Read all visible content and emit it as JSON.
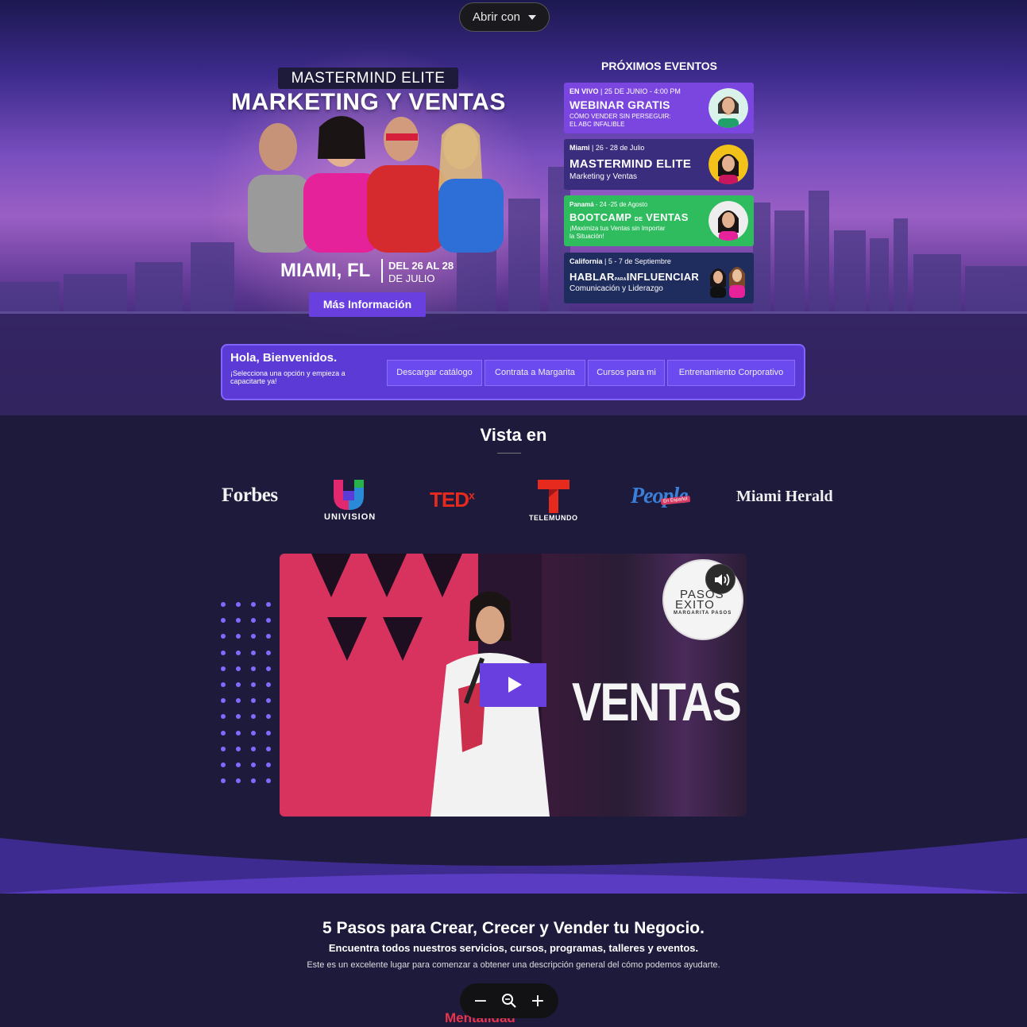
{
  "open_with": {
    "label": "Abrir con"
  },
  "hero": {
    "pill": "MASTERMIND ELITE",
    "title": "MARKETING Y VENTAS",
    "city": "MIAMI, FL",
    "date_line1": "DEL 26 AL 28",
    "date_line2": "DE JULIO",
    "cta": "Más Información"
  },
  "events": {
    "heading": "PRÓXIMOS EVENTOS",
    "items": [
      {
        "meta_strong": "EN VIVO",
        "meta": " | 25 DE JUNIO - 4:00 PM",
        "name": "WEBINAR GRATIS",
        "line1": "CÓMO VENDER SIN PERSEGUIR:",
        "line2": "EL ABC INFALIBLE"
      },
      {
        "meta_strong": "Miami",
        "meta": " | 26 - 28 de Julio",
        "name": "MASTERMIND ELITE",
        "line1": "Marketing y Ventas"
      },
      {
        "meta_strong": "Panamá",
        "meta": " - 24 -25 de Agosto",
        "name_a": "BOOTCAMP",
        "name_small": "DE",
        "name_b": "VENTAS",
        "line1": "¡Maximiza tus Ventas sin Importar",
        "line2": "la Situación!"
      },
      {
        "meta_strong": "California",
        "meta": "  | 5 - 7 de Septiembre",
        "name_a": "HABLAR",
        "name_small": "PARA",
        "name_b": "INFLUENCIAR",
        "line1": "Comunicación y Liderazgo"
      }
    ]
  },
  "welcome": {
    "greeting": "Hola, Bienvenidos.",
    "prompt": "¡Selecciona una opción y empieza a capacitarte ya!",
    "buttons": [
      "Descargar catálogo",
      "Contrata a Margarita",
      "Cursos para mi",
      "Entrenamiento Corporativo"
    ]
  },
  "press": {
    "heading": "Vista en",
    "logos": [
      "Forbes",
      "UNIVISION",
      "TED",
      "x",
      "TELEMUNDO",
      "People",
      "En Español",
      "Miami Herald"
    ]
  },
  "video": {
    "overlay_text": "VENTAS",
    "badge_line1": "PASOS",
    "badge_line2": "EXITO",
    "badge_line3": "MARGARITA PASOS"
  },
  "steps": {
    "title": "5 Pasos para Crear, Crecer y Vender tu Negocio.",
    "subtitle": "Encuentra todos nuestros servicios, cursos, programas, talleres y eventos.",
    "description": "Este es un excelente lugar para comenzar a obtener una descripción general del cómo podemos ayudarte.",
    "first_step": "Mentalidad"
  },
  "zoom": {
    "minus": "−",
    "plus": "+"
  },
  "colors": {
    "accent": "#6a3fe0",
    "event_green": "#2ebc5e",
    "red": "#e8354a",
    "bg": "#1e1a3c"
  }
}
